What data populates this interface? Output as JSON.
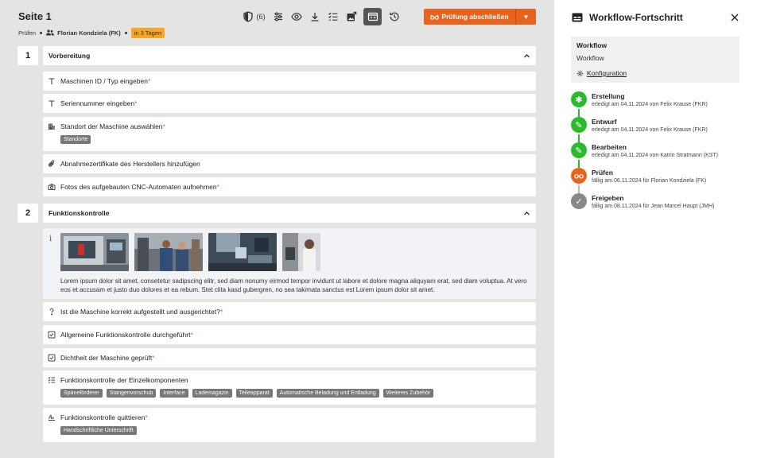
{
  "header": {
    "title": "Seite 1",
    "breadcrumb_step": "Prüfen",
    "person": "Florian Kondziela (FK)",
    "due_badge": "in 3 Tagen",
    "comment_count": "(6)",
    "finish_label": "Prüfung abschließen"
  },
  "sections": [
    {
      "number": "1",
      "title": "Vorbereitung",
      "items": [
        {
          "icon": "text-icon",
          "label": "Maschinen ID / Typ eingeben",
          "required": "*"
        },
        {
          "icon": "text-icon",
          "label": "Seriennummer eingeben",
          "required": "*"
        },
        {
          "icon": "location-list-icon",
          "label": "Standort der Maschine auswählen",
          "required": "*",
          "tags": [
            "Standorte"
          ]
        },
        {
          "icon": "paperclip-icon",
          "label": "Abnahmezertifikate des Herstellers hinzufügen",
          "required": ""
        },
        {
          "icon": "camera-icon",
          "label": "Fotos des aufgebauten CNC-Automaten aufnehmen",
          "required": "*"
        }
      ]
    },
    {
      "number": "2",
      "title": "Funktionskontrolle",
      "info_text": "Lorem ipsum dolor sit amet, consetetur sadipscing elitr, sed diam nonumy eirmod tempor invidunt ut labore et dolore magna aliquyam erat, sed diam voluptua. At vero eos et accusam et justo duo dolores et ea rebum. Stet clita kasd gubergren, no sea takimata sanctus est Lorem ipsum dolor sit amet.",
      "items": [
        {
          "icon": "question-icon",
          "label": "Ist die Maschine korrekt aufgestellt und ausgerichtet?",
          "required": "*"
        },
        {
          "icon": "checkbox-icon",
          "label": "Allgemeine Funktionskontrolle durchgeführt",
          "required": "*"
        },
        {
          "icon": "checkbox-icon",
          "label": "Dichtheit der Maschine geprüft",
          "required": "*"
        },
        {
          "icon": "checklist-icon",
          "label": "Funktionskontrolle der Einzelkomponenten",
          "required": "",
          "tags": [
            "Späneförderer",
            "Stangenvorschub",
            "Interface",
            "Lademagazin",
            "Teileapparat",
            "Automatische Beladung und Entladung",
            "Weiteres Zubehör"
          ]
        },
        {
          "icon": "signature-icon",
          "label": "Funktionskontrolle quittieren",
          "required": "*",
          "tags": [
            "Handschriftliche Unterschrift"
          ]
        }
      ]
    }
  ],
  "panel": {
    "title": "Workflow-Fortschritt",
    "workflow_heading": "Workflow",
    "workflow_name": "Workflow",
    "config_link": "Konfiguration",
    "steps": [
      {
        "name": "Erstellung",
        "detail": "erledigt am 04.11.2024 von Felix Krause (FKR)",
        "color": "#2eb82e",
        "icon": "asterisk-icon"
      },
      {
        "name": "Entwurf",
        "detail": "erledigt am 04.11.2024 von Felix Krause (FKR)",
        "color": "#2eb82e",
        "icon": "pencil-icon"
      },
      {
        "name": "Bearbeiten",
        "detail": "erledigt am 04.11.2024 von Katrin Stratmann (KST)",
        "color": "#2eb82e",
        "icon": "pencil-icon"
      },
      {
        "name": "Prüfen",
        "detail": "fällig am 06.11.2024 für Florian Kondziela (FK)",
        "color": "#e8631d",
        "icon": "glasses-icon"
      },
      {
        "name": "Freigeben",
        "detail": "fällig am 08.11.2024 für Jean Marcel Haupt (JMH)",
        "color": "#888888",
        "icon": "check-icon"
      }
    ]
  },
  "colors": {
    "accent": "#e8631d",
    "done": "#2eb82e",
    "pending": "#888888",
    "due_badge": "#f5a623"
  }
}
